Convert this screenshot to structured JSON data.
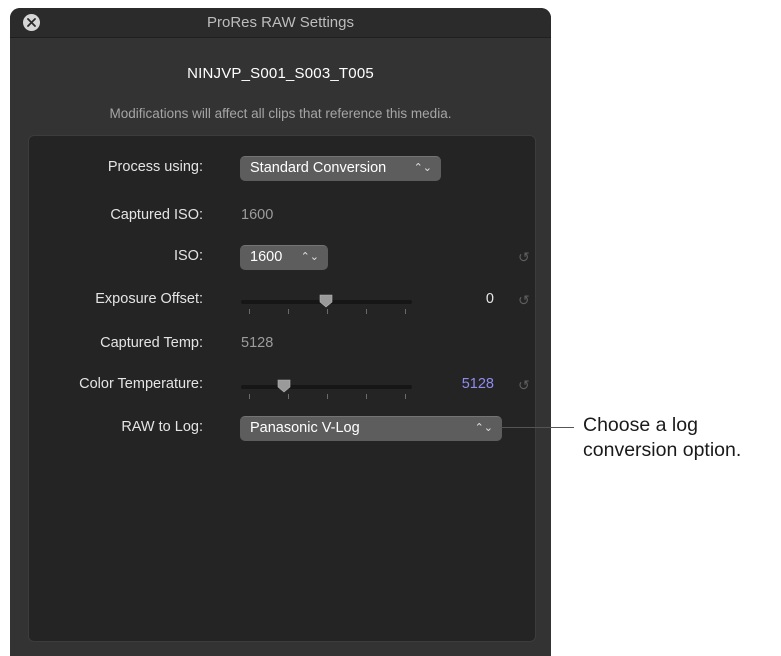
{
  "window": {
    "title": "ProRes RAW Settings",
    "clip_name": "NINJVP_S001_S003_T005",
    "note": "Modifications will affect all clips that reference this media."
  },
  "settings": {
    "process_using": {
      "label": "Process using:",
      "value": "Standard Conversion"
    },
    "captured_iso": {
      "label": "Captured ISO:",
      "value": "1600"
    },
    "iso": {
      "label": "ISO:",
      "value": "1600"
    },
    "exposure_offset": {
      "label": "Exposure Offset:",
      "value": "0",
      "slider_level": 0.5
    },
    "captured_temp": {
      "label": "Captured Temp:",
      "value": "5128"
    },
    "color_temperature": {
      "label": "Color Temperature:",
      "value": "5128",
      "slider_level": 0.25
    },
    "raw_to_log": {
      "label": "RAW to Log:",
      "value": "Panasonic V-Log"
    }
  },
  "callout": {
    "line1": "Choose a log",
    "line2": "conversion option."
  },
  "colors": {
    "accent_value": "#8f8cf0",
    "panel": "#242424",
    "window": "#333333"
  },
  "icons": {
    "close": "close-icon",
    "reset": "reset-icon",
    "popup_chevron": "chevron-updown-icon"
  }
}
